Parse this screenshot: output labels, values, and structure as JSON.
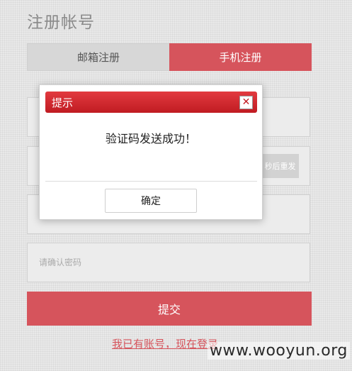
{
  "page": {
    "title": "注册帐号"
  },
  "tabs": [
    {
      "label": "邮箱注册",
      "active": false
    },
    {
      "label": "手机注册",
      "active": true
    }
  ],
  "form": {
    "phone_placeholder": "",
    "code_placeholder": "",
    "resend_label": "秒后重发",
    "password_placeholder": "",
    "confirm_password_placeholder": "请确认密码",
    "submit_label": "提交",
    "login_link": "我已有账号，现在登录"
  },
  "modal": {
    "title": "提示",
    "close_glyph": "✕",
    "message": "验证码发送成功！",
    "ok_label": "确定"
  },
  "watermark": "www.wooyun.org",
  "colors": {
    "accent": "#d6545c",
    "modal_header": "#c01b22",
    "inactive_tab": "#d7d7d7"
  }
}
